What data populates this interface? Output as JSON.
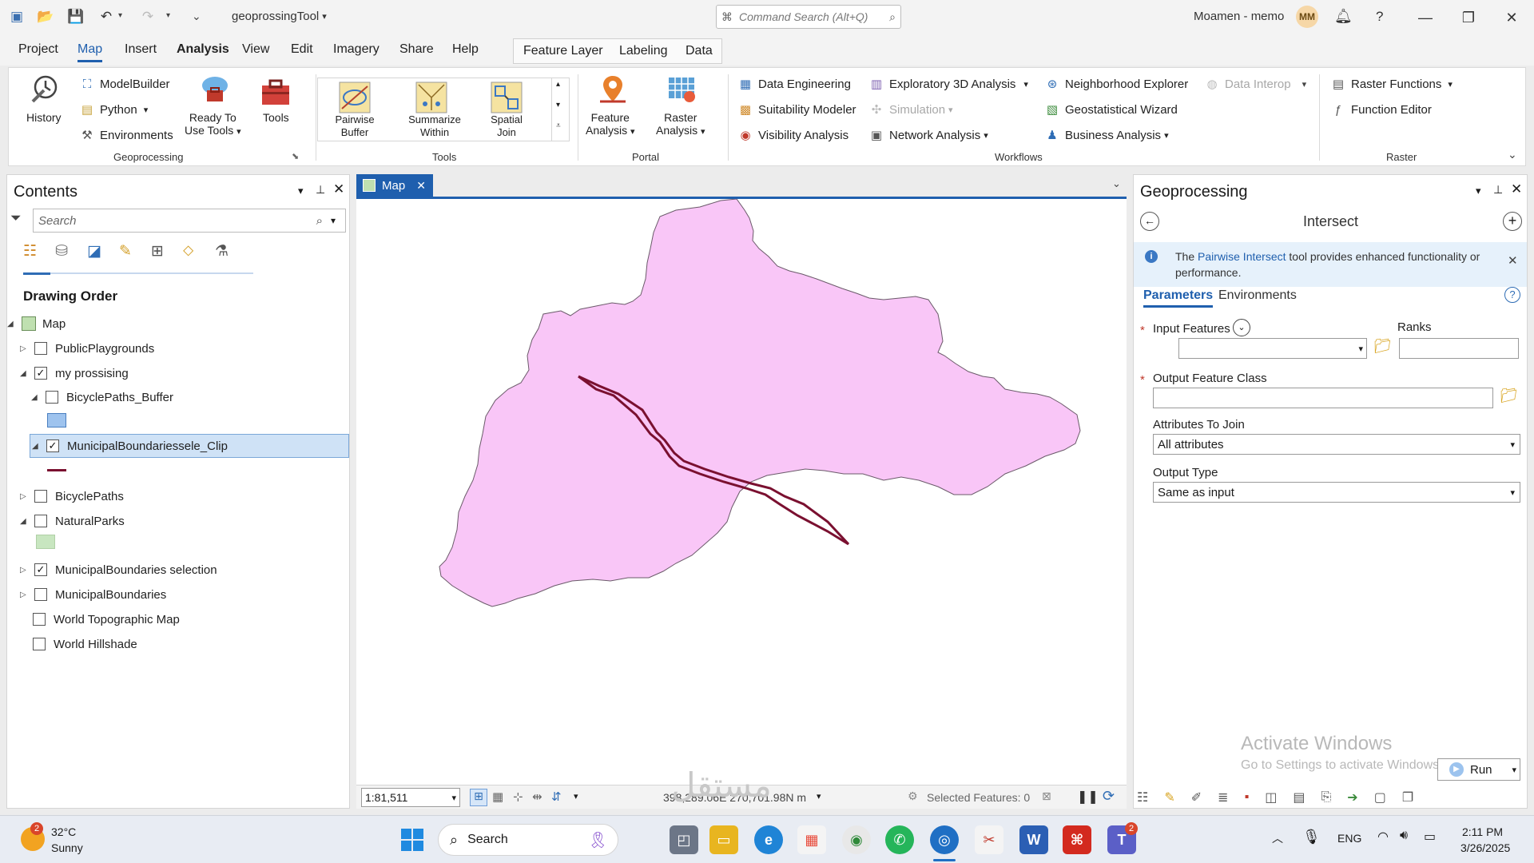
{
  "app": {
    "title": "geoprossingTool",
    "command_search_placeholder": "Command Search (Alt+Q)",
    "user_name": "Moamen - memo",
    "user_initials": "MM"
  },
  "menu": {
    "tabs": [
      "Project",
      "Map",
      "Insert",
      "Analysis",
      "View",
      "Edit",
      "Imagery",
      "Share",
      "Help"
    ],
    "active_tab": "Map",
    "bold_tab": "Analysis",
    "context_tabs": [
      "Feature Layer",
      "Labeling",
      "Data"
    ]
  },
  "ribbon": {
    "geoprocessing": {
      "label": "Geoprocessing",
      "history": "History",
      "modelbuilder": "ModelBuilder",
      "python": "Python",
      "environments": "Environments",
      "ready_to_use_tools_1": "Ready To",
      "ready_to_use_tools_2": "Use Tools",
      "tools": "Tools"
    },
    "tools": {
      "label": "Tools",
      "gallery": [
        {
          "line1": "Pairwise",
          "line2": "Buffer"
        },
        {
          "line1": "Summarize",
          "line2": "Within"
        },
        {
          "line1": "Spatial",
          "line2": "Join"
        }
      ]
    },
    "portal": {
      "label": "Portal",
      "feature_analysis_1": "Feature",
      "feature_analysis_2": "Analysis",
      "raster_analysis_1": "Raster",
      "raster_analysis_2": "Analysis"
    },
    "workflows": {
      "label": "Workflows",
      "data_engineering": "Data Engineering",
      "suitability_modeler": "Suitability Modeler",
      "visibility_analysis": "Visibility Analysis",
      "exploratory_3d": "Exploratory 3D Analysis",
      "simulation": "Simulation",
      "network_analysis": "Network Analysis",
      "neighborhood_explorer": "Neighborhood Explorer",
      "geostatistical_wizard": "Geostatistical Wizard",
      "business_analysis": "Business Analysis",
      "data_interop": "Data Interop"
    },
    "raster": {
      "label": "Raster",
      "raster_functions": "Raster Functions",
      "function_editor": "Function Editor"
    }
  },
  "contents": {
    "title": "Contents",
    "search_placeholder": "Search",
    "drawing_order": "Drawing Order",
    "map_label": "Map",
    "layers": {
      "public_playgrounds": "PublicPlaygrounds",
      "my_prossising": "my prossising",
      "bicycle_paths_buffer": "BicyclePaths_Buffer",
      "municipal_clip": "MunicipalBoundariessele_Clip",
      "bicycle_paths": "BicyclePaths",
      "natural_parks": "NaturalParks",
      "municipal_selection": "MunicipalBoundaries selection",
      "municipal_boundaries": "MunicipalBoundaries",
      "world_topo": "World Topographic Map",
      "world_hillshade": "World Hillshade"
    }
  },
  "map": {
    "tab_label": "Map",
    "scale": "1:81,511",
    "coordinates": "398,289.06E 270,701.98N m",
    "selected_features": "Selected Features: 0",
    "polygon_fill": "#f9c6f7",
    "line_color": "#7a1030"
  },
  "geoprocessing": {
    "title": "Geoprocessing",
    "tool_name": "Intersect",
    "info_prefix": "The",
    "info_link": "Pairwise Intersect",
    "info_suffix": "tool provides enhanced functionality or performance.",
    "tab_parameters": "Parameters",
    "tab_environments": "Environments",
    "input_features": "Input Features",
    "ranks": "Ranks",
    "output_feature_class": "Output Feature Class",
    "attributes_to_join": "Attributes To Join",
    "attributes_value": "All attributes",
    "output_type": "Output Type",
    "output_type_value": "Same as input",
    "run": "Run",
    "activate_title": "Activate Windows",
    "activate_sub": "Go to Settings to activate Windows."
  },
  "taskbar": {
    "weather_temp": "32°C",
    "weather_desc": "Sunny",
    "weather_badge": "2",
    "search": "Search",
    "language": "ENG",
    "time": "2:11 PM",
    "date": "3/26/2025",
    "teams_badge": "2",
    "word_letter": "W",
    "teams_letter": "T"
  }
}
